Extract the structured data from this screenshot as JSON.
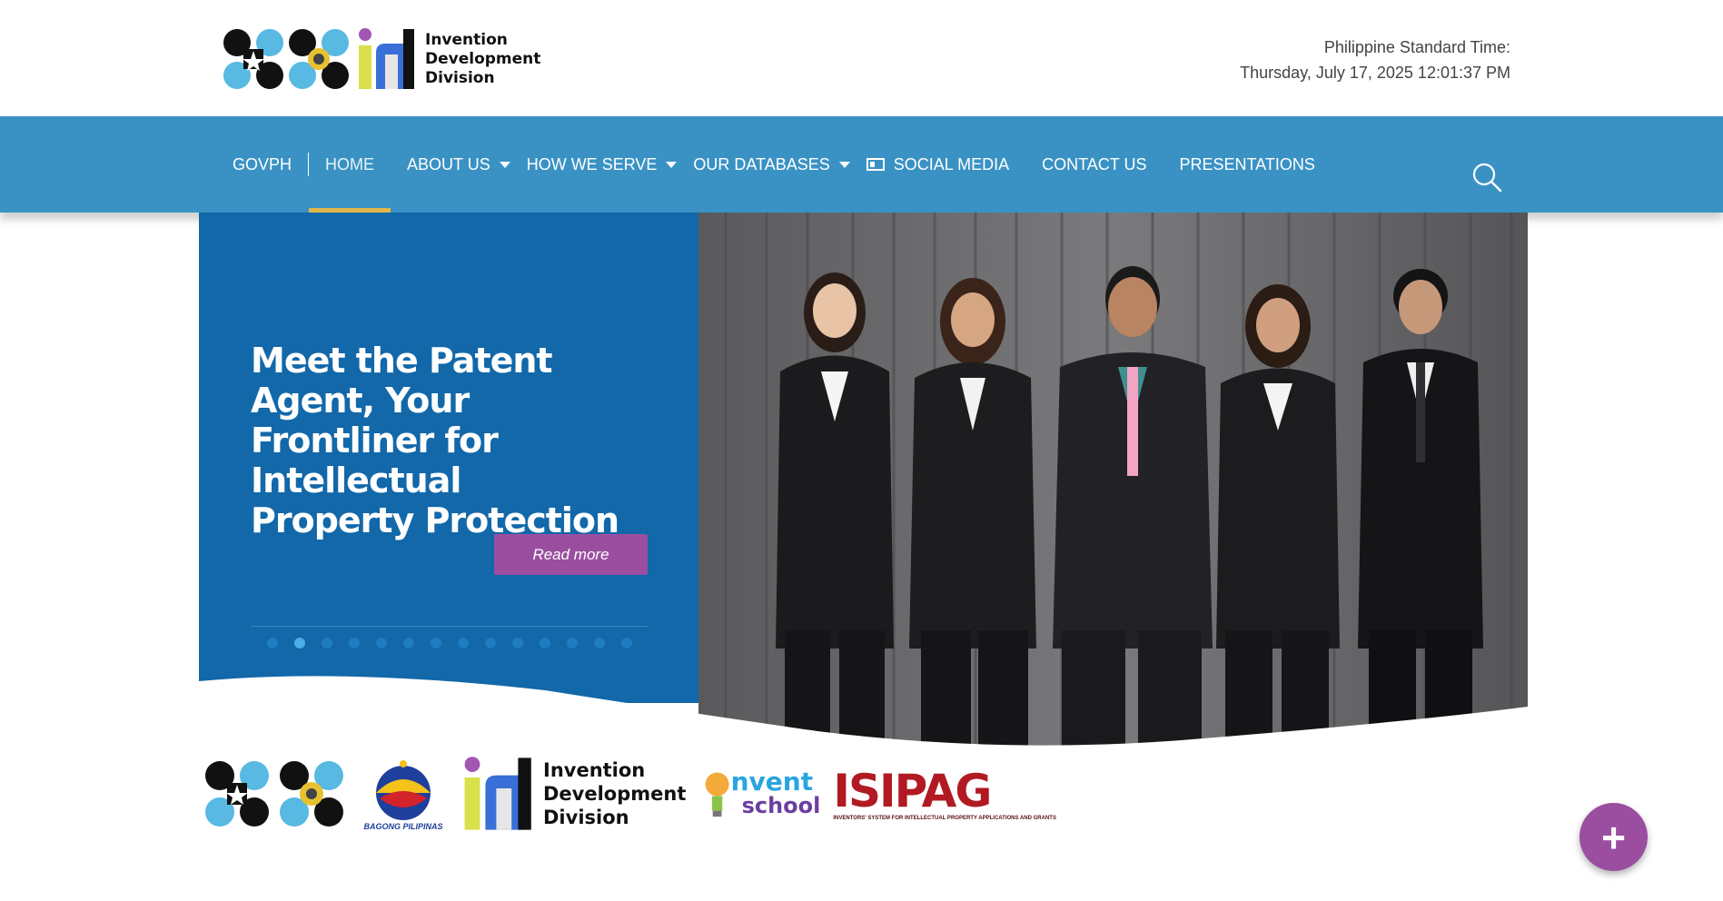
{
  "header": {
    "logo_text": [
      "Invention",
      "Development",
      "Division"
    ],
    "pst_label": "Philippine Standard Time:",
    "pst_value": "Thursday, July 17, 2025 12:01:37 PM"
  },
  "nav": {
    "items": [
      {
        "label": "GOVPH"
      },
      {
        "label": "HOME",
        "active": true
      },
      {
        "label": "ABOUT US",
        "dropdown": true
      },
      {
        "label": "HOW WE SERVE",
        "dropdown": true
      },
      {
        "label": "OUR DATABASES",
        "dropdown": true
      },
      {
        "label": "SOCIAL MEDIA",
        "icon": "id-card-icon"
      },
      {
        "label": "CONTACT US"
      },
      {
        "label": "PRESENTATIONS"
      }
    ],
    "search_icon": "search-icon"
  },
  "hero": {
    "title": "Meet the Patent Agent, Your Frontliner for Intellectual Property Protection",
    "button": "Read more",
    "slide_count": 14,
    "active_slide": 2
  },
  "partners": {
    "bagong_pilipinas": "BAGONG PILIPINAS",
    "idd_text": [
      "Invention",
      "Development",
      "Division"
    ],
    "invent_school": [
      "nvent",
      "school"
    ],
    "isipag": "ISIPAG",
    "isipag_sub": "INVENTORS' SYSTEM FOR INTELLECTUAL PROPERTY APPLICATIONS AND GRANTS"
  },
  "colors": {
    "nav_bg": "#3a92c4",
    "hero_bg": "#1268a9",
    "accent_purple": "#9b4ea0",
    "active_underline": "#e0b64a"
  },
  "fab": {
    "icon": "plus-icon"
  }
}
